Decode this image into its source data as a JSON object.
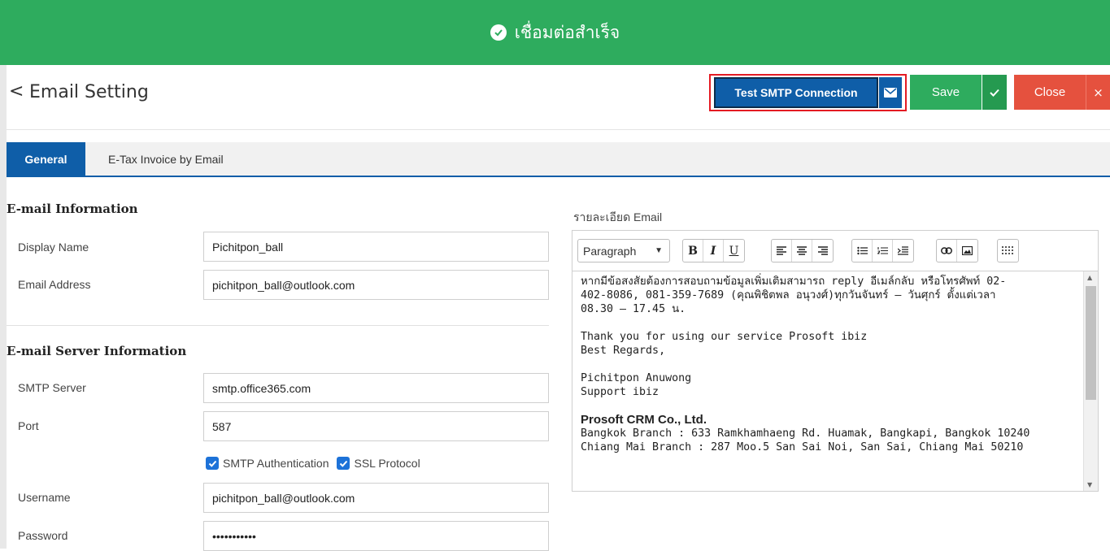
{
  "banner": {
    "message": "เชื่อมต่อสำเร็จ",
    "icon": "check-circle-icon"
  },
  "header": {
    "back_glyph": "<",
    "title": "Email Setting"
  },
  "actions": {
    "test_label": "Test SMTP Connection",
    "save_label": "Save",
    "close_label": "Close",
    "close_glyph": "×"
  },
  "tabs": [
    {
      "label": "General",
      "active": true
    },
    {
      "label": "E-Tax Invoice by Email",
      "active": false
    }
  ],
  "email_info": {
    "title": "E-mail Information",
    "display_name_label": "Display Name",
    "display_name_value": "Pichitpon_ball",
    "email_label": "Email Address",
    "email_value": "pichitpon_ball@outlook.com"
  },
  "server_info": {
    "title": "E-mail Server Information",
    "smtp_label": "SMTP Server",
    "smtp_value": "smtp.office365.com",
    "port_label": "Port",
    "port_value": "587",
    "auth_label": "SMTP Authentication",
    "auth_checked": true,
    "ssl_label": "SSL Protocol",
    "ssl_checked": true,
    "username_label": "Username",
    "username_value": "pichitpon_ball@outlook.com",
    "password_label": "Password",
    "password_value": "•••••••••••"
  },
  "editor": {
    "label": "รายละเอียด Email",
    "format_value": "Paragraph",
    "format_caret": "▼",
    "lines": [
      "หากมีข้อสงสัยต้องการสอบถามข้อมูลเพิ่มเติมสามารถ reply อีเมล์กลับ หรือโทรศัพท์ 02-",
      "402-8086, 081-359-7689 (คุณพิชิตพล อนุวงศ์)ทุกวันจันทร์ – วันศุกร์ ตั้งแต่เวลา",
      "08.30 – 17.45 น.",
      "",
      "Thank you for using our service Prosoft ibiz",
      "Best Regards,",
      "",
      "Pichitpon Anuwong",
      "Support ibiz",
      ""
    ],
    "company": "Prosoft CRM Co., Ltd.",
    "branch_lines": [
      "Bangkok Branch : 633 Ramkhamhaeng Rd. Huamak, Bangkapi, Bangkok 10240",
      "Chiang Mai Branch : 287 Moo.5 San Sai Noi, San Sai, Chiang Mai 50210"
    ]
  },
  "colors": {
    "success": "#2eac5e",
    "primary": "#0f5ea8",
    "danger": "#e5513e",
    "highlight": "#e41b23"
  }
}
